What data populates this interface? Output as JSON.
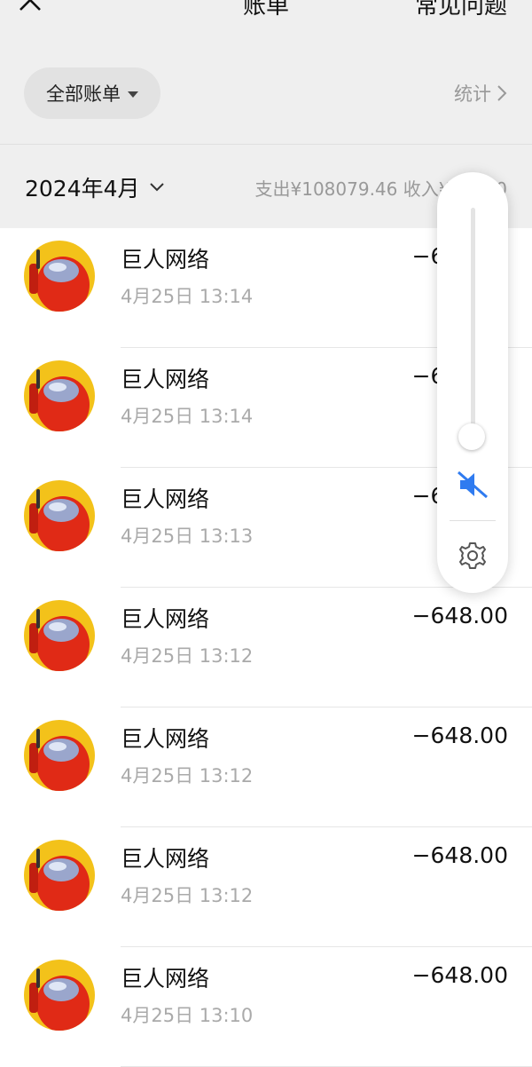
{
  "header": {
    "title": "账单",
    "faq_label": "常见问题"
  },
  "filter": {
    "label": "全部账单",
    "stats_label": "统计"
  },
  "month": {
    "label": "2024年4月",
    "summary": "支出¥108079.46  收入¥…0.00"
  },
  "transactions": [
    {
      "name": "巨人网络",
      "time": "4月25日 13:14",
      "amount": "−648.00"
    },
    {
      "name": "巨人网络",
      "time": "4月25日 13:14",
      "amount": "−648.00"
    },
    {
      "name": "巨人网络",
      "time": "4月25日 13:13",
      "amount": "−648.00"
    },
    {
      "name": "巨人网络",
      "time": "4月25日 13:12",
      "amount": "−648.00"
    },
    {
      "name": "巨人网络",
      "time": "4月25日 13:12",
      "amount": "−648.00"
    },
    {
      "name": "巨人网络",
      "time": "4月25日 13:12",
      "amount": "−648.00"
    },
    {
      "name": "巨人网络",
      "time": "4月25日 13:10",
      "amount": "−648.00"
    }
  ],
  "volume": {
    "level": 0.0,
    "muted": true,
    "mute_icon": "speaker-mute-icon",
    "settings_icon": "gear-icon"
  },
  "colors": {
    "accent": "#2f7bf0",
    "avatar_bg": "#f3c21a",
    "avatar_red": "#e02a16"
  }
}
